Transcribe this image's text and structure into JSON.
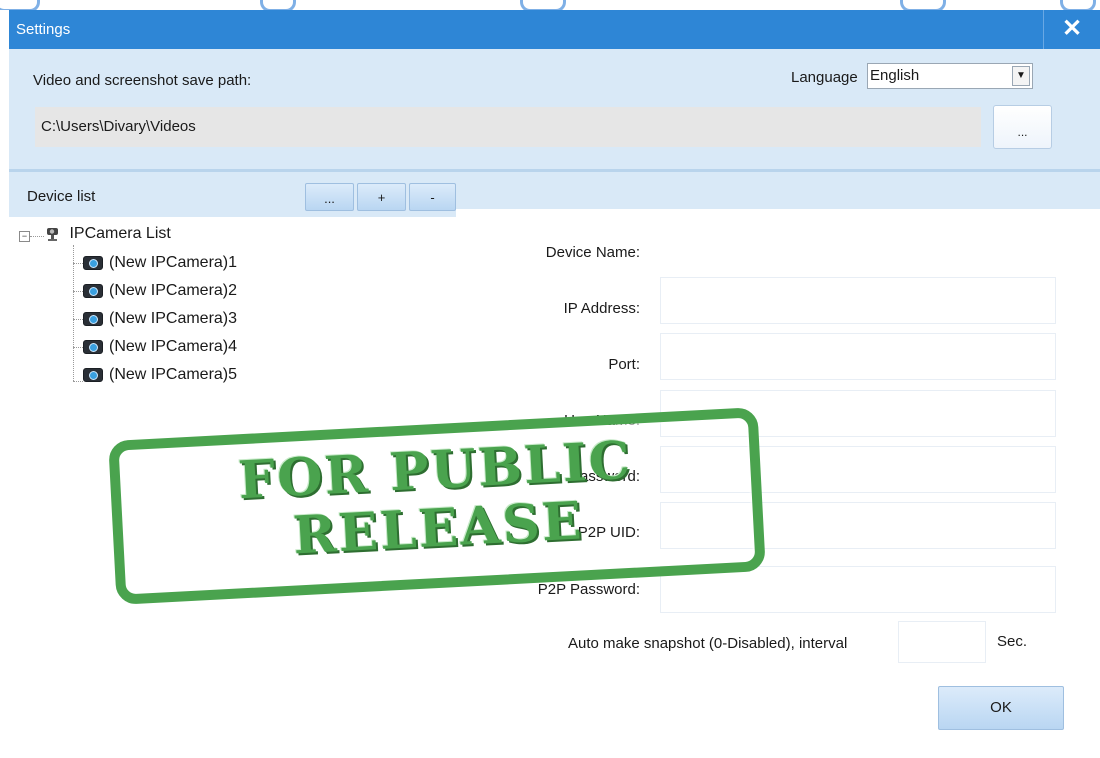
{
  "window": {
    "title": "Settings",
    "close_glyph": "✕"
  },
  "top": {
    "save_path_label": "Video and screenshot save path:",
    "save_path_value": "C:\\Users\\Divary\\Videos",
    "browse_label": "...",
    "language_label": "Language",
    "language_value": "English"
  },
  "device_list": {
    "label": "Device list",
    "btn_more": "...",
    "btn_add": "+",
    "btn_remove": "-",
    "root": "IPCamera List",
    "items": [
      "(New IPCamera)1",
      "(New IPCamera)2",
      "(New IPCamera)3",
      "(New IPCamera)4",
      "(New IPCamera)5"
    ]
  },
  "form": {
    "device_name": "Device Name:",
    "ip_address": "IP Address:",
    "port": "Port:",
    "username": "UserName:",
    "password": "Password:",
    "p2p_uid": "P2P UID:",
    "p2p_password": "P2P Password:",
    "snapshot_label": "Auto make snapshot (0-Disabled), interval",
    "snapshot_unit": "Sec.",
    "ok_label": "OK"
  },
  "watermark": {
    "line1": "FOR PUBLIC",
    "line2": "RELEASE"
  },
  "colors": {
    "titlebar": "#2e86d6",
    "panel": "#d9e9f7",
    "stamp": "#4aa34e"
  }
}
